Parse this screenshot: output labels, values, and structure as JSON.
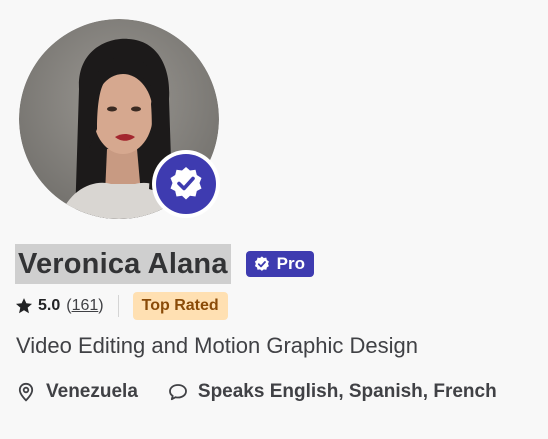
{
  "profile": {
    "name": "Veronica Alana",
    "pro_label": "Pro",
    "rating": "5.0",
    "review_count": "161",
    "badge": "Top Rated",
    "tagline": "Video Editing and Motion Graphic Design",
    "location": "Venezuela",
    "languages": "Speaks English, Spanish, French"
  },
  "icons": {
    "verified": "verified-check-icon",
    "pro": "pro-shield-icon",
    "star": "star-icon",
    "location": "location-pin-icon",
    "languages": "speech-bubble-icon"
  },
  "colors": {
    "accent": "#3e3bb0",
    "top_rated_bg": "#ffe0b2",
    "top_rated_text": "#8a4b08"
  }
}
